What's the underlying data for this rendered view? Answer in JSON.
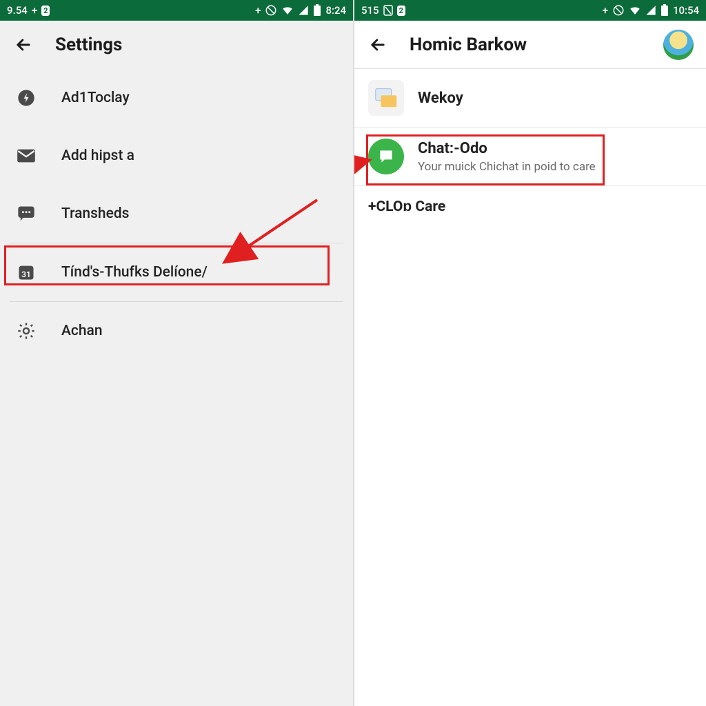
{
  "colors": {
    "accent": "#0b6b3a",
    "highlight": "#e02020",
    "green_icon": "#3bb54a"
  },
  "left": {
    "status": {
      "left_text": "9.54",
      "badge": "2",
      "time": "8:24"
    },
    "title": "Settings",
    "items": [
      {
        "icon": "bolt-icon",
        "label": "Ad1Toclay"
      },
      {
        "icon": "mail-icon",
        "label": "Add hipst a"
      },
      {
        "icon": "chat-icon",
        "label": "Transheds"
      },
      {
        "icon": "calendar-icon",
        "label": "Tínd's-Thufks Delíone/"
      },
      {
        "icon": "gear-icon",
        "label": "Achan"
      }
    ],
    "highlight_index": 3
  },
  "right": {
    "status": {
      "left_text": "515",
      "badge": "2",
      "time": "10:54"
    },
    "title": "Homic Barkow",
    "items": [
      {
        "title": "Wekoy",
        "subtitle": ""
      },
      {
        "title": "Chat:-Odo",
        "subtitle": "Your muick Chichat in poid to care"
      }
    ],
    "add_label": "+CLOɒ Care",
    "highlight_index": 1
  }
}
